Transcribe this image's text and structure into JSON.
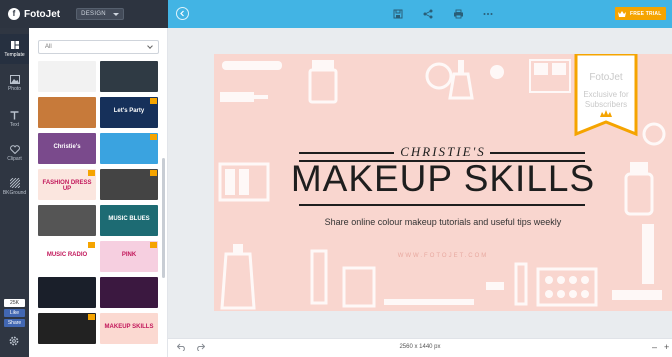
{
  "app": {
    "brand": "FotoJet",
    "mode": "DESIGN",
    "trial_label": "FREE TRIAL"
  },
  "colors": {
    "topbar": "#42b4e4",
    "sidebar": "#2f3642",
    "canvas_bg": "#f9d6cf",
    "accent": "#f5a400"
  },
  "toolbar": {
    "icons": [
      "save-icon",
      "share-icon",
      "print-icon",
      "more-icon"
    ]
  },
  "rail": {
    "items": [
      {
        "label": "Template",
        "icon": "template-icon"
      },
      {
        "label": "Photo",
        "icon": "photo-icon"
      },
      {
        "label": "Text",
        "icon": "text-icon"
      },
      {
        "label": "Clipart",
        "icon": "clipart-icon"
      },
      {
        "label": "BKGround",
        "icon": "background-icon"
      }
    ],
    "fb_count": "25K",
    "fb_like": "Like",
    "fb_share": "Share"
  },
  "panel": {
    "filter_value": "All",
    "thumbs": [
      {
        "text": "",
        "bg": "#f2f2f2",
        "crown": false
      },
      {
        "text": "",
        "bg": "#2f3a44",
        "crown": false
      },
      {
        "text": "",
        "bg": "#c77a3a",
        "crown": false
      },
      {
        "text": "Let's Party",
        "bg": "#16305a",
        "crown": true
      },
      {
        "text": "Christie's",
        "bg": "#7a4a8c",
        "crown": false
      },
      {
        "text": "",
        "bg": "#3aa3e0",
        "crown": true
      },
      {
        "text": "FASHION DRESS UP",
        "bg": "#fbe6df",
        "crown": true
      },
      {
        "text": "",
        "bg": "#444",
        "crown": true
      },
      {
        "text": "",
        "bg": "#555",
        "crown": false
      },
      {
        "text": "MUSIC BLUES",
        "bg": "#1d6b73",
        "crown": false
      },
      {
        "text": "MUSIC RADIO",
        "bg": "#ffffff",
        "crown": true
      },
      {
        "text": "PINK",
        "bg": "#f6cfe0",
        "crown": true
      },
      {
        "text": "",
        "bg": "#1a1f2a",
        "crown": false
      },
      {
        "text": "",
        "bg": "#3b1840",
        "crown": false
      },
      {
        "text": "",
        "bg": "#222",
        "crown": true
      },
      {
        "text": "MAKEUP SKILLS",
        "bg": "#fbd9d1",
        "crown": false
      }
    ]
  },
  "design": {
    "name_line": "CHRISTIE'S",
    "title": "MAKEUP SKILLS",
    "subtitle": "Share online colour makeup tutorials and useful tips weekly",
    "website": "WWW.FOTOJET.COM",
    "ribbon_brand": "FotoJet",
    "ribbon_line1": "Exclusive for",
    "ribbon_line2": "Subscribers"
  },
  "status": {
    "canvas_size": "2560 x 1440 px",
    "zoom_out": "–",
    "zoom_in": "+"
  }
}
